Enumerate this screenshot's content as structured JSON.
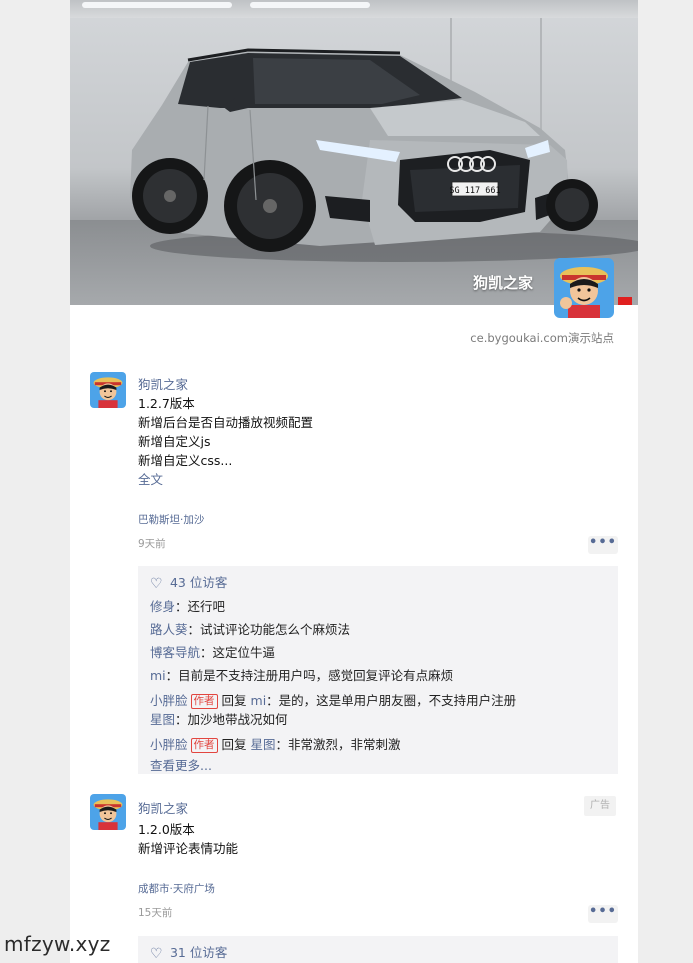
{
  "cover": {
    "name": "狗凯之家",
    "plate": "SG 117 661",
    "site_link": "ce.bygoukai.com演示站点"
  },
  "posts": [
    {
      "author": "狗凯之家",
      "lines": [
        "1.2.7版本",
        "新增后台是否自动播放视频配置",
        "新增自定义js",
        "新增自定义css..."
      ],
      "full_text": "全文",
      "location": "巴勒斯坦·加沙",
      "time": "9天前",
      "more": "•••",
      "likes": "43 位访客",
      "comments": [
        {
          "name": "修身",
          "text": "：还行吧"
        },
        {
          "name": "路人葵",
          "text": "：试试评论功能怎么个麻烦法"
        },
        {
          "name": "博客导航",
          "text": "：这定位牛逼"
        },
        {
          "name": "mi",
          "text": "：目前是不支持注册用户吗，感觉回复评论有点麻烦"
        }
      ],
      "replies": [
        {
          "name": "小胖脸",
          "tag": "作者",
          "reply_word": "回复",
          "to": "mi",
          "text": "：是的，这是单用户朋友圈，不支持用户注册"
        },
        {
          "name": "星图",
          "text": "：加沙地带战况如何"
        },
        {
          "name": "小胖脸",
          "tag": "作者",
          "reply_word": "回复",
          "to": "星图",
          "text": "：非常激烈，非常刺激"
        }
      ],
      "see_more": "查看更多..."
    },
    {
      "author": "狗凯之家",
      "ad": "广告",
      "lines": [
        "1.2.0版本",
        "新增评论表情功能"
      ],
      "location": "成都市·天府广场",
      "time": "15天前",
      "more": "•••",
      "likes": "31 位访客"
    }
  ],
  "watermark": "mfzyw.xyz"
}
